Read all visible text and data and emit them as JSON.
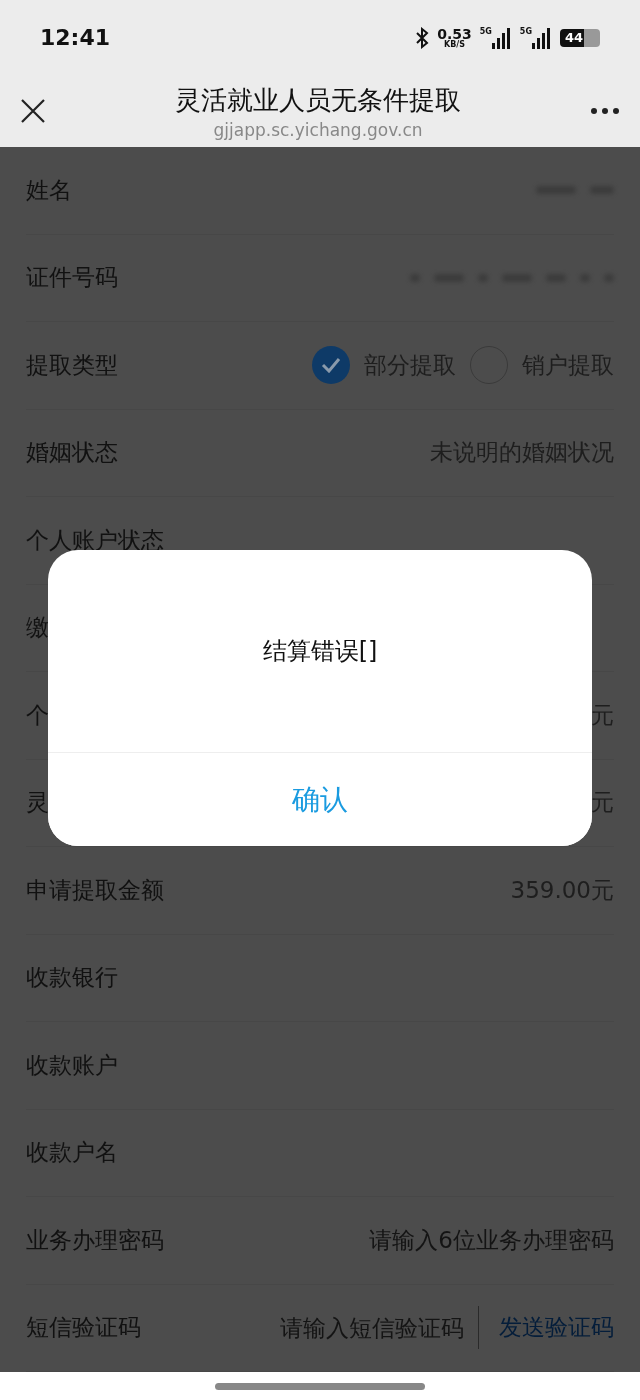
{
  "status_bar": {
    "time": "12:41",
    "speed": "0.53",
    "speed_unit": "KB/S",
    "signals": [
      "5G",
      "5G"
    ],
    "battery": "44"
  },
  "header": {
    "title": "灵活就业人员无条件提取",
    "url": "gjjapp.sc.yichang.gov.cn"
  },
  "rows": [
    {
      "kind": "blurred",
      "label": "姓名"
    },
    {
      "kind": "blurred",
      "label": "证件号码"
    },
    {
      "kind": "radio",
      "label": "提取类型",
      "options": [
        {
          "label": "部分提取",
          "selected": true
        },
        {
          "label": "销户提取",
          "selected": false
        }
      ]
    },
    {
      "kind": "value",
      "label": "婚姻状态",
      "value": "未说明的婚姻状况"
    },
    {
      "kind": "value",
      "label": "个人账户状态"
    },
    {
      "kind": "value",
      "label": "缴"
    },
    {
      "kind": "value",
      "label": "个",
      "value": "元"
    },
    {
      "kind": "value",
      "label": "灵",
      "value": "元"
    },
    {
      "kind": "value",
      "label": "申请提取金额",
      "value": "359.00元"
    },
    {
      "kind": "value",
      "label": "收款银行"
    },
    {
      "kind": "value",
      "label": "收款账户"
    },
    {
      "kind": "value",
      "label": "收款户名"
    },
    {
      "kind": "input",
      "label": "业务办理密码",
      "placeholder": "请输入6位业务办理密码"
    },
    {
      "kind": "sms",
      "label": "短信验证码",
      "placeholder": "请输入短信验证码",
      "action": "发送验证码"
    }
  ],
  "dialog": {
    "message": "结算错误[]",
    "button": "确认"
  }
}
